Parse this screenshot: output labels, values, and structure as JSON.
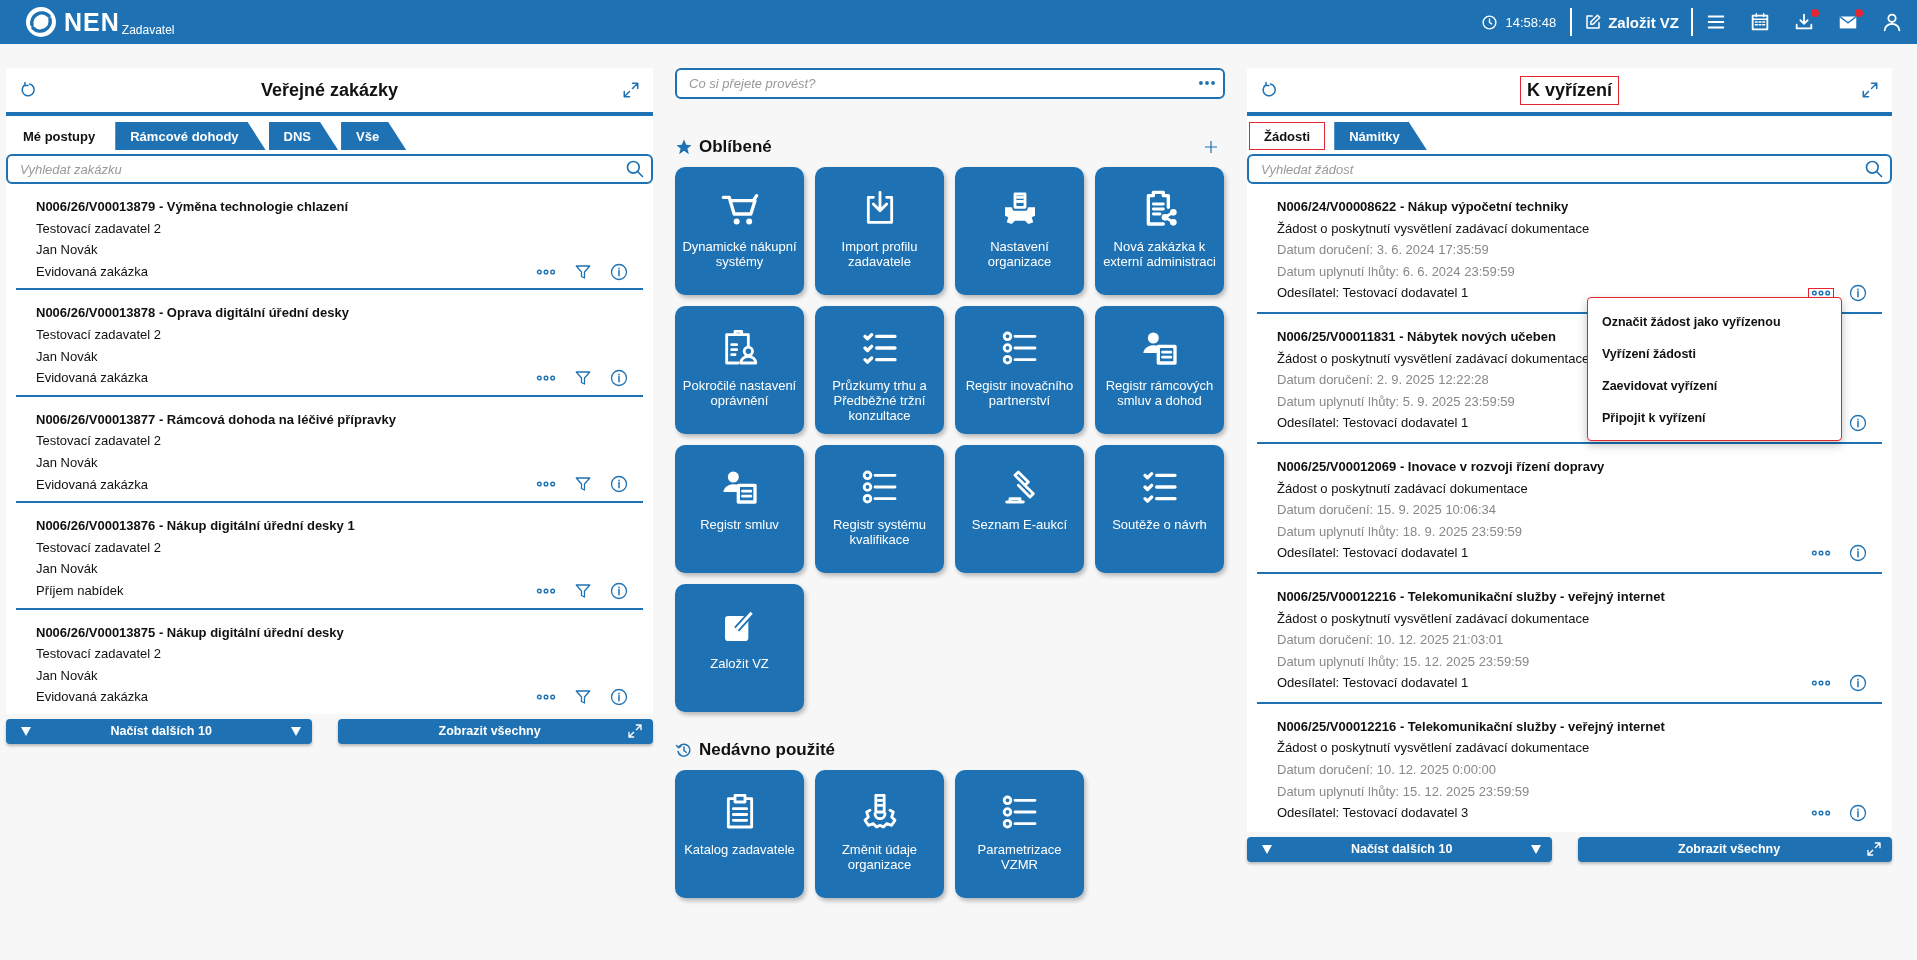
{
  "header": {
    "logo": "NEN",
    "subtitle": "Zadavatel",
    "time": "14:58:48",
    "create_button": "Založit VZ",
    "icons": [
      {
        "badge": false
      },
      {
        "badge": false
      },
      {
        "badge": true
      },
      {
        "badge": true
      },
      {
        "badge": false
      }
    ]
  },
  "left_panel": {
    "title": "Veřejné zakázky",
    "tabs": [
      {
        "label": "Mé postupy",
        "selected": true
      },
      {
        "label": "Rámcové dohody",
        "selected": false
      },
      {
        "label": "DNS",
        "selected": false
      },
      {
        "label": "Vše",
        "selected": false
      }
    ],
    "search": {
      "placeholder": "Vyhledat zakázku"
    },
    "items": [
      {
        "title": "N006/26/V00013879 - Výměna technologie chlazení",
        "lines": [
          "Testovací zadavatel 2",
          "Jan Novák",
          "Evidovaná zakázka"
        ]
      },
      {
        "title": "N006/26/V00013878 - Oprava digitální úřední desky",
        "lines": [
          "Testovací zadavatel 2",
          "Jan Novák",
          "Evidovaná zakázka"
        ]
      },
      {
        "title": "N006/26/V00013877 - Rámcová dohoda na léčivé přípravky",
        "lines": [
          "Testovací zadavatel 2",
          "Jan Novák",
          "Evidovaná zakázka"
        ]
      },
      {
        "title": "N006/26/V00013876 - Nákup digitální úřední desky 1",
        "lines": [
          "Testovací zadavatel 2",
          "Jan Novák",
          "Příjem nabídek"
        ]
      },
      {
        "title": "N006/26/V00013875 - Nákup digitální úřední desky",
        "lines": [
          "Testovací zadavatel 2",
          "Jan Novák",
          "Evidovaná zakázka"
        ]
      }
    ],
    "load_more": "Načíst dalších 10",
    "show_all": "Zobrazit všechny"
  },
  "center": {
    "command_search": {
      "placeholder": "Co si přejete provést?"
    },
    "favorites": {
      "title": "Oblíbené",
      "tiles": [
        {
          "label": "Dynamické nákupní systémy"
        },
        {
          "label": "Import profilu zadavatele"
        },
        {
          "label": "Nastavení organizace"
        },
        {
          "label": "Nová zakázka k externí administraci"
        },
        {
          "label": "Pokročilé nastavení oprávnění"
        },
        {
          "label": "Průzkumy trhu a Předběžné tržní konzultace"
        },
        {
          "label": "Registr inovačního partnerství"
        },
        {
          "label": "Registr rámcových smluv a dohod"
        },
        {
          "label": "Registr smluv"
        },
        {
          "label": "Registr systému kvalifikace"
        },
        {
          "label": "Seznam E-aukcí"
        },
        {
          "label": "Soutěže o návrh"
        },
        {
          "label": "Založit VZ"
        }
      ]
    },
    "recent": {
      "title": "Nedávno použité",
      "tiles": [
        {
          "label": "Katalog zadavatele"
        },
        {
          "label": "Změnit údaje organizace"
        },
        {
          "label": "Parametrizace VZMR"
        }
      ]
    }
  },
  "right_panel": {
    "title": "K vyřízení",
    "title_highlighted": true,
    "tabs": [
      {
        "label": "Žádosti",
        "selected": true,
        "highlighted": true
      },
      {
        "label": "Námitky",
        "selected": false,
        "highlighted": false
      }
    ],
    "search": {
      "placeholder": "Vyhledat žádost"
    },
    "items": [
      {
        "title": "N006/24/V00008622 - Nákup výpočetní techniky",
        "subject": "Žádost o poskytnutí vysvětlení zadávací dokumentace",
        "delivered": "Datum doručení: 3. 6. 2024 17:35:59",
        "deadline": "Datum uplynutí lhůty: 6. 6. 2024 23:59:59",
        "sender": "Odesílatel: Testovací dodavatel 1",
        "more_highlighted": true,
        "menu_open": true
      },
      {
        "title": "N006/25/V00011831 - Nábytek nových učeben",
        "subject": "Žádost o poskytnutí vysvětlení zadávací dokumentace",
        "delivered": "Datum doručení: 2. 9. 2025 12:22:28",
        "deadline": "Datum uplynutí lhůty: 5. 9. 2025 23:59:59",
        "sender": "Odesílatel: Testovací dodavatel 1",
        "menu_open": false
      },
      {
        "title": "N006/25/V00012069 - Inovace v rozvoji řízení dopravy",
        "subject": "Žádost o poskytnutí zadávací dokumentace",
        "delivered": "Datum doručení: 15. 9. 2025 10:06:34",
        "deadline": "Datum uplynutí lhůty: 18. 9. 2025 23:59:59",
        "sender": "Odesílatel: Testovací dodavatel 1",
        "more_highlighted": false,
        "menu_open": false
      },
      {
        "title": "N006/25/V00012216 - Telekomunikační služby - veřejný internet",
        "subject": "Žádost o poskytnutí vysvětlení zadávací dokumentace",
        "delivered": "Datum doručení: 10. 12. 2025 21:03:01",
        "deadline": "Datum uplynutí lhůty: 15. 12. 2025 23:59:59",
        "sender": "Odesílatel: Testovací dodavatel 1",
        "more_highlighted": false,
        "menu_open": false
      },
      {
        "title": "N006/25/V00012216 - Telekomunikační služby - veřejný internet",
        "subject": "Žádost o poskytnutí vysvětlení zadávací dokumentace",
        "delivered": "Datum doručení: 10. 12. 2025 0:00:00",
        "deadline": "Datum uplynutí lhůty: 15. 12. 2025 23:59:59",
        "sender": "Odesílatel: Testovací dodavatel 3",
        "more_highlighted": false,
        "menu_open": false
      }
    ],
    "context_menu": {
      "highlighted": true,
      "items": [
        "Označit žádost jako vyřízenou",
        "Vyřízení žádosti",
        "Zaevidovat vyřízení",
        "Připojit k vyřízení"
      ]
    },
    "load_more": "Načíst dalších 10",
    "show_all": "Zobrazit všechny"
  }
}
